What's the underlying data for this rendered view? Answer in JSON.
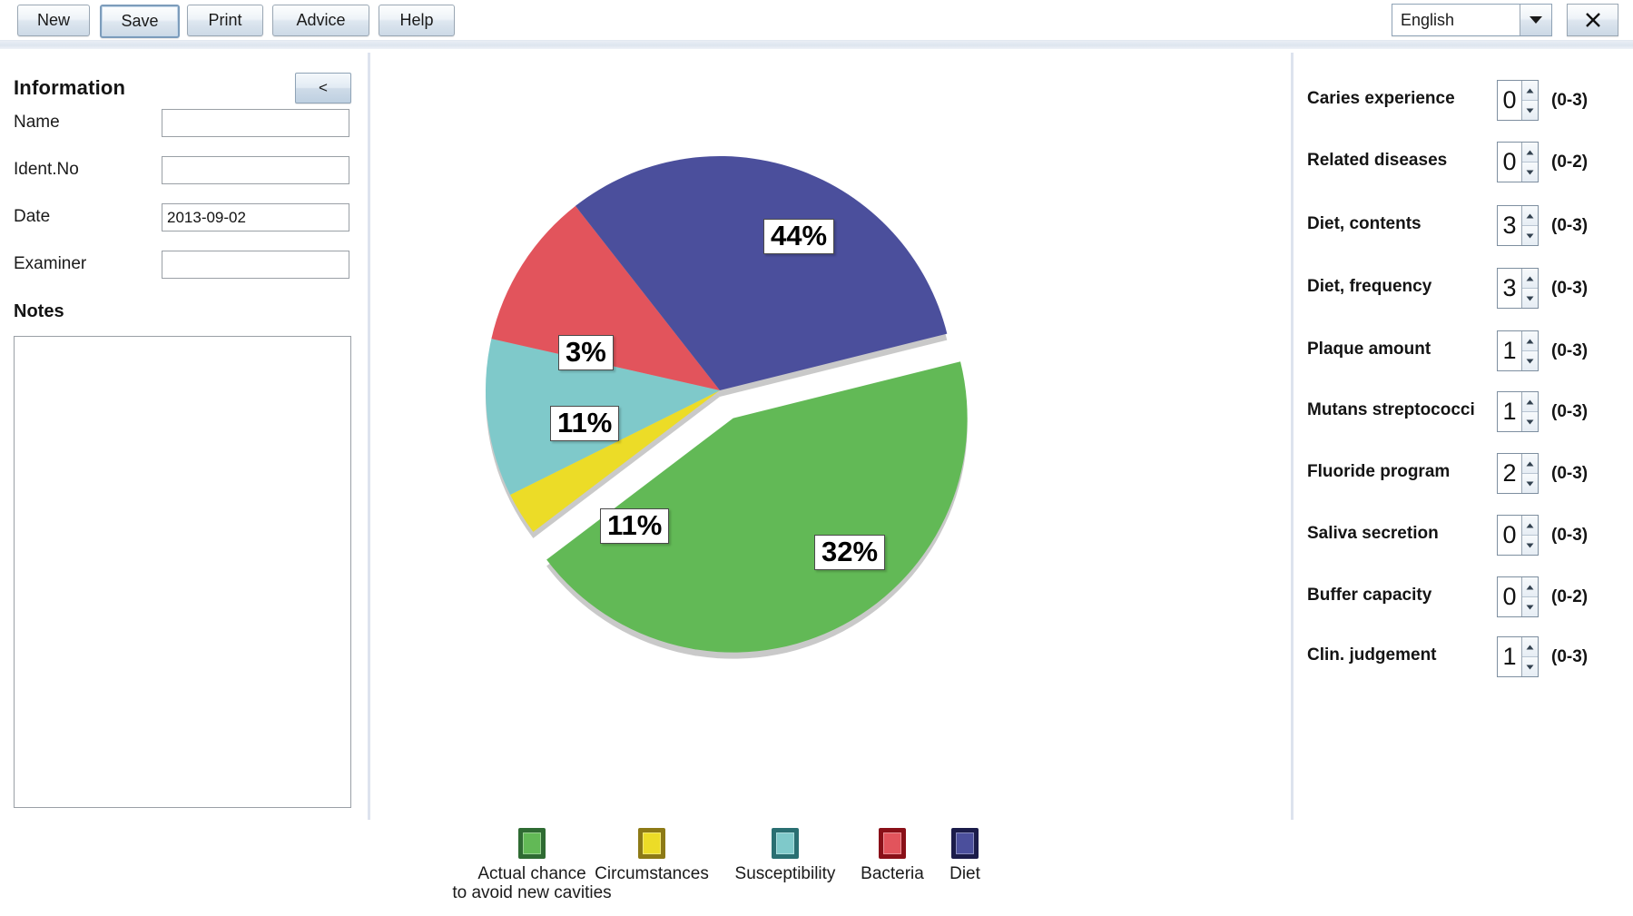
{
  "toolbar": {
    "buttons": [
      {
        "label": "New",
        "name": "new-button"
      },
      {
        "label": "Save",
        "name": "save-button"
      },
      {
        "label": "Print",
        "name": "print-button"
      },
      {
        "label": "Advice",
        "name": "advice-button"
      },
      {
        "label": "Help",
        "name": "help-button"
      }
    ],
    "language": {
      "value": "English",
      "options": [
        "English"
      ]
    },
    "close_label": "✕"
  },
  "information": {
    "title": "Information",
    "collapse_label": "<",
    "fields": [
      {
        "label": "Name",
        "value": "",
        "placeholder": ""
      },
      {
        "label": "Ident.No",
        "value": "",
        "placeholder": ""
      },
      {
        "label": "Date",
        "value": "2013-09-02",
        "placeholder": ""
      },
      {
        "label": "Examiner",
        "value": "",
        "placeholder": ""
      }
    ],
    "notes_title": "Notes",
    "notes_value": "",
    "notes_placeholder": ""
  },
  "parameters": [
    {
      "label": "Caries experience",
      "value": "0",
      "range": "(0-3)"
    },
    {
      "label": "Related diseases",
      "value": "0",
      "range": "(0-2)"
    },
    {
      "label": "Diet, contents",
      "value": "3",
      "range": "(0-3)"
    },
    {
      "label": "Diet, frequency",
      "value": "3",
      "range": "(0-3)"
    },
    {
      "label": "Plaque amount",
      "value": "1",
      "range": "(0-3)"
    },
    {
      "label": "Mutans streptococci",
      "value": "1",
      "range": "(0-3)"
    },
    {
      "label": "Fluoride program",
      "value": "2",
      "range": "(0-3)"
    },
    {
      "label": "Saliva secretion",
      "value": "0",
      "range": "(0-3)"
    },
    {
      "label": "Buffer capacity",
      "value": "0",
      "range": "(0-2)"
    },
    {
      "label": "Clin. judgement",
      "value": "1",
      "range": "(0-3)"
    }
  ],
  "chart_data": {
    "type": "pie",
    "title": "",
    "categories": [
      "Actual chance\nto avoid new cavities",
      "Circumstances",
      "Susceptibility",
      "Bacteria",
      "Diet"
    ],
    "values": [
      44,
      3,
      11,
      11,
      32
    ],
    "labels": [
      "44%",
      "3%",
      "11%",
      "11%",
      "32%"
    ],
    "colors": [
      "#62b956",
      "#ecdc27",
      "#7fc9ca",
      "#e2545c",
      "#4b4f9c"
    ],
    "legend_border_colors": [
      "#2f6b33",
      "#8d7a16",
      "#2a6f72",
      "#8a1018",
      "#1b1c4a"
    ],
    "exploded": [
      true,
      false,
      false,
      false,
      false
    ],
    "legend_position": "bottom",
    "grid": false
  }
}
